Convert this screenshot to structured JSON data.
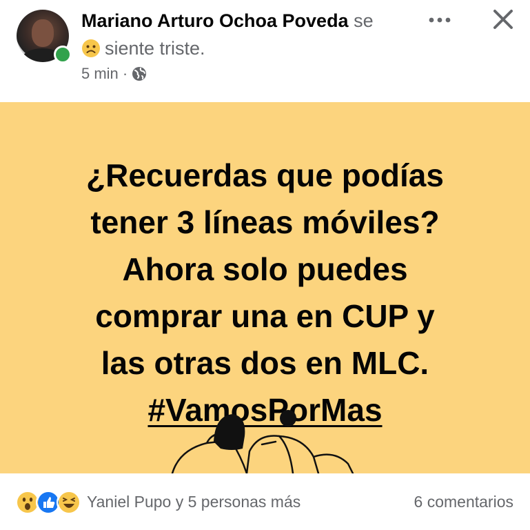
{
  "post": {
    "author": "Mariano Arturo Ochoa Poveda",
    "se": "se",
    "feeling": "siente triste.",
    "time": "5 min",
    "separator": "·",
    "privacy_icon": "globe-icon",
    "more_icon": "more-dots-icon",
    "close_icon": "close-icon",
    "text_lines": [
      "¿Recuerdas que podías",
      "tener 3 líneas móviles?",
      "Ahora solo puedes",
      "comprar una en CUP y",
      "las otras dos en MLC."
    ],
    "hashtag": "#VamosPorMas",
    "background_color": "#fcd47e"
  },
  "footer": {
    "reactions": [
      "wow-reaction-icon",
      "like-reaction-icon",
      "haha-reaction-icon"
    ],
    "reactors_text": "Yaniel Pupo y 5 personas más",
    "comments_text": "6 comentarios"
  }
}
